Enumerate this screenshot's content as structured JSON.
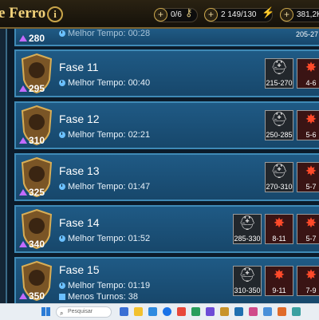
{
  "header": {
    "title": "e Ferro",
    "info_glyph": "i",
    "resources": [
      {
        "value": "0/6",
        "icon": "key-icon",
        "color": "#d9c27a"
      },
      {
        "value": "2 149/130",
        "icon": "energy-bolt-icon",
        "color": "#ffd21a"
      },
      {
        "value": "381,2K",
        "icon": "silver-coin-icon",
        "color": "#d9d9d9"
      }
    ]
  },
  "levels": [
    {
      "name": "",
      "level": "280",
      "best_time_label": "Melhor Tempo:",
      "best_time": "00:28",
      "rewards": [
        {
          "range": "205-27"
        }
      ]
    },
    {
      "name": "Fase 11",
      "level": "295",
      "best_time_label": "Melhor Tempo:",
      "best_time": "00:40",
      "rewards": [
        {
          "range": "215-270",
          "type": "silver-helmet-icon"
        },
        {
          "range": "4-6",
          "type": "red-shard-icon"
        }
      ]
    },
    {
      "name": "Fase 12",
      "level": "310",
      "best_time_label": "Melhor Tempo:",
      "best_time": "02:21",
      "rewards": [
        {
          "range": "250-285",
          "type": "silver-helmet-icon"
        },
        {
          "range": "5-6",
          "type": "red-shard-icon"
        }
      ]
    },
    {
      "name": "Fase 13",
      "level": "325",
      "best_time_label": "Melhor Tempo:",
      "best_time": "01:47",
      "rewards": [
        {
          "range": "270-310",
          "type": "silver-helmet-icon"
        },
        {
          "range": "5-7",
          "type": "red-shard-icon"
        }
      ]
    },
    {
      "name": "Fase 14",
      "level": "340",
      "best_time_label": "Melhor Tempo:",
      "best_time": "01:52",
      "rewards": [
        {
          "range": "285-330",
          "type": "silver-helmet-icon"
        },
        {
          "range": "8-11",
          "type": "red-shard-icon"
        },
        {
          "range": "5-7",
          "type": "red-shard-icon"
        }
      ]
    },
    {
      "name": "Fase 15",
      "level": "350",
      "best_time_label": "Melhor Tempo:",
      "best_time": "01:19",
      "min_turns_label": "Menos Turnos:",
      "min_turns": "38",
      "rewards": [
        {
          "range": "310-350",
          "type": "silver-helmet-icon"
        },
        {
          "range": "9-11",
          "type": "red-shard-icon"
        },
        {
          "range": "7-9",
          "type": "red-shard-icon"
        }
      ]
    }
  ],
  "taskbar": {
    "search_placeholder": "Pesquisar"
  }
}
